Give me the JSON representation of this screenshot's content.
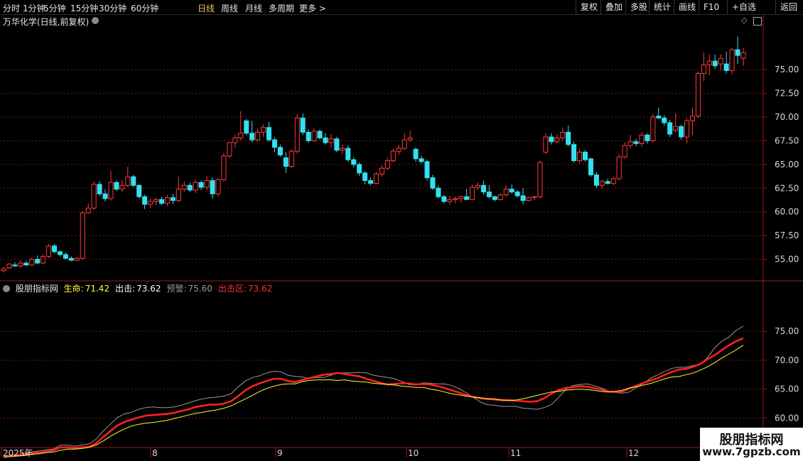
{
  "toolbar": {
    "periods": [
      "分时",
      "1分钟",
      "5分钟",
      "15分钟",
      "30分钟",
      "60分钟",
      "日线",
      "周线",
      "月线",
      "多周期",
      "更多 >"
    ],
    "active_period": "日线",
    "right_buttons": [
      "复权",
      "叠加",
      "多股",
      "统计",
      "画线",
      "F10",
      "+自选",
      "返回"
    ]
  },
  "stock_title": "万华化学(日线,前复权)",
  "indicator": {
    "name": "股朋指标网",
    "items": [
      {
        "label": "生命:",
        "value": "71.42",
        "color": "#ffff40"
      },
      {
        "label": "出击:",
        "value": "73.62",
        "color": "#ffffff"
      },
      {
        "label": "预警:",
        "value": "75.60",
        "color": "#9a9a9a"
      },
      {
        "label": "出击区:",
        "value": "73.62",
        "color": "#ff3030"
      }
    ]
  },
  "colors": {
    "up": "#ff3b3b",
    "down": "#33e0f0",
    "grid": "#7a1515",
    "axis": "#a01818"
  },
  "watermark": {
    "line1": "股朋指标网",
    "line2": "www.7gpzb.com"
  },
  "chart_data": [
    {
      "type": "candlestick",
      "title": "万华化学(日线,前复权)",
      "y_ticks": [
        55.0,
        57.5,
        60.0,
        62.5,
        65.0,
        67.5,
        70.0,
        72.5,
        75.0
      ],
      "ylim": [
        52.8,
        79.5
      ],
      "x_labels": [
        "2025年",
        "8",
        "9",
        "10",
        "11",
        "12"
      ],
      "ohlc": [
        [
          53.8,
          54.2,
          53.6,
          54.0
        ],
        [
          54.1,
          54.6,
          54.0,
          54.5
        ],
        [
          54.4,
          54.7,
          54.2,
          54.3
        ],
        [
          54.3,
          54.9,
          54.1,
          54.6
        ],
        [
          54.6,
          54.8,
          54.3,
          54.4
        ],
        [
          54.4,
          55.2,
          54.3,
          55.0
        ],
        [
          55.0,
          55.4,
          54.5,
          54.6
        ],
        [
          54.6,
          55.5,
          54.5,
          55.3
        ],
        [
          55.3,
          56.6,
          55.1,
          56.4
        ],
        [
          56.4,
          56.6,
          55.6,
          55.8
        ],
        [
          55.8,
          55.9,
          55.3,
          55.5
        ],
        [
          55.5,
          55.7,
          55.0,
          55.1
        ],
        [
          55.1,
          55.3,
          54.8,
          54.9
        ],
        [
          54.9,
          55.2,
          54.8,
          55.1
        ],
        [
          55.1,
          60.1,
          55.0,
          59.9
        ],
        [
          59.9,
          60.9,
          59.8,
          60.4
        ],
        [
          60.4,
          63.2,
          60.2,
          62.9
        ],
        [
          62.9,
          63.2,
          61.7,
          61.9
        ],
        [
          61.9,
          62.4,
          61.1,
          61.4
        ],
        [
          61.4,
          64.3,
          61.2,
          63.1
        ],
        [
          63.1,
          63.3,
          62.2,
          62.4
        ],
        [
          62.4,
          63.4,
          62.1,
          62.8
        ],
        [
          62.8,
          64.8,
          62.6,
          63.7
        ],
        [
          63.7,
          63.9,
          62.6,
          62.8
        ],
        [
          62.8,
          62.9,
          61.4,
          61.6
        ],
        [
          61.6,
          61.8,
          60.3,
          60.8
        ],
        [
          60.8,
          61.4,
          60.4,
          61.1
        ],
        [
          61.1,
          61.5,
          60.7,
          61.3
        ],
        [
          61.3,
          61.6,
          60.7,
          60.9
        ],
        [
          60.9,
          61.8,
          60.6,
          61.5
        ],
        [
          61.5,
          61.9,
          60.8,
          61.2
        ],
        [
          61.2,
          63.7,
          61.0,
          62.4
        ],
        [
          62.4,
          63.2,
          62.1,
          62.8
        ],
        [
          62.8,
          63.1,
          62.1,
          62.3
        ],
        [
          62.3,
          63.4,
          62.0,
          63.1
        ],
        [
          63.1,
          63.3,
          62.3,
          62.6
        ],
        [
          62.6,
          63.8,
          62.3,
          63.3
        ],
        [
          63.3,
          63.6,
          61.4,
          61.9
        ],
        [
          61.9,
          63.6,
          61.6,
          63.4
        ],
        [
          63.4,
          66.2,
          63.2,
          65.9
        ],
        [
          65.9,
          67.4,
          65.7,
          67.3
        ],
        [
          67.3,
          68.1,
          66.8,
          67.8
        ],
        [
          67.8,
          70.6,
          67.5,
          68.3
        ],
        [
          69.6,
          69.8,
          68.1,
          68.3
        ],
        [
          68.3,
          69.6,
          67.3,
          67.6
        ],
        [
          67.6,
          68.8,
          67.4,
          68.4
        ],
        [
          68.4,
          69.2,
          67.9,
          68.9
        ],
        [
          68.9,
          69.5,
          67.4,
          67.6
        ],
        [
          67.6,
          67.9,
          66.3,
          66.8
        ],
        [
          66.8,
          67.1,
          65.8,
          66.0
        ],
        [
          65.7,
          66.3,
          64.1,
          64.8
        ],
        [
          64.8,
          66.6,
          64.6,
          66.4
        ],
        [
          66.4,
          70.3,
          66.1,
          69.9
        ],
        [
          69.9,
          70.4,
          68.1,
          68.4
        ],
        [
          68.4,
          68.7,
          67.3,
          67.5
        ],
        [
          67.5,
          68.8,
          67.4,
          68.5
        ],
        [
          68.5,
          68.7,
          67.6,
          67.8
        ],
        [
          67.8,
          68.3,
          67.1,
          67.3
        ],
        [
          67.3,
          68.2,
          66.8,
          67.7
        ],
        [
          67.7,
          67.9,
          66.3,
          66.5
        ],
        [
          66.5,
          67.1,
          66.1,
          66.7
        ],
        [
          66.7,
          67.0,
          65.3,
          65.5
        ],
        [
          65.5,
          65.8,
          64.7,
          65.0
        ],
        [
          65.0,
          65.2,
          63.8,
          64.1
        ],
        [
          64.1,
          64.3,
          62.9,
          63.3
        ],
        [
          63.3,
          63.6,
          62.8,
          63.0
        ],
        [
          63.0,
          64.2,
          62.9,
          64.0
        ],
        [
          64.0,
          64.9,
          63.7,
          64.6
        ],
        [
          64.6,
          65.7,
          64.4,
          65.4
        ],
        [
          65.4,
          66.7,
          65.2,
          66.4
        ],
        [
          66.4,
          67.1,
          66.0,
          66.7
        ],
        [
          66.7,
          68.3,
          66.5,
          67.6
        ],
        [
          67.6,
          68.6,
          67.4,
          67.8
        ],
        [
          66.6,
          66.8,
          65.3,
          65.6
        ],
        [
          65.6,
          65.9,
          65.1,
          65.3
        ],
        [
          65.3,
          65.5,
          63.3,
          63.6
        ],
        [
          63.6,
          63.9,
          62.3,
          62.5
        ],
        [
          62.5,
          62.8,
          61.4,
          61.6
        ],
        [
          61.6,
          61.8,
          60.9,
          61.1
        ],
        [
          61.1,
          61.7,
          60.8,
          61.3
        ],
        [
          61.3,
          61.6,
          60.9,
          61.4
        ],
        [
          61.4,
          61.7,
          61.0,
          61.6
        ],
        [
          61.6,
          62.4,
          61.3,
          61.3
        ],
        [
          61.3,
          62.9,
          61.2,
          62.6
        ],
        [
          62.6,
          63.1,
          62.3,
          62.8
        ],
        [
          62.8,
          63.3,
          61.8,
          62.1
        ],
        [
          62.1,
          62.8,
          61.4,
          61.6
        ],
        [
          61.6,
          61.7,
          61.1,
          61.3
        ],
        [
          61.3,
          61.9,
          61.2,
          61.8
        ],
        [
          61.8,
          62.8,
          61.6,
          62.4
        ],
        [
          62.4,
          62.9,
          61.9,
          62.1
        ],
        [
          62.1,
          62.3,
          61.5,
          61.7
        ],
        [
          61.7,
          62.5,
          60.8,
          61.2
        ],
        [
          61.2,
          61.6,
          61.1,
          61.5
        ],
        [
          61.5,
          61.7,
          61.2,
          61.6
        ],
        [
          61.6,
          65.4,
          61.4,
          65.2
        ],
        [
          66.3,
          68.3,
          66.1,
          67.9
        ],
        [
          67.9,
          68.3,
          67.1,
          67.4
        ],
        [
          67.4,
          68.2,
          67.2,
          67.8
        ],
        [
          67.8,
          68.9,
          67.5,
          68.4
        ],
        [
          68.4,
          69.1,
          66.9,
          67.1
        ],
        [
          67.1,
          67.4,
          65.2,
          65.4
        ],
        [
          65.4,
          66.7,
          65.1,
          66.3
        ],
        [
          66.3,
          66.5,
          65.3,
          65.5
        ],
        [
          65.6,
          65.7,
          63.7,
          63.9
        ],
        [
          63.9,
          64.2,
          62.5,
          62.8
        ],
        [
          62.8,
          63.4,
          62.4,
          63.2
        ],
        [
          63.2,
          63.5,
          62.9,
          63.0
        ],
        [
          63.0,
          63.7,
          62.8,
          63.5
        ],
        [
          63.5,
          66.1,
          63.3,
          65.8
        ],
        [
          65.8,
          67.3,
          65.6,
          67.0
        ],
        [
          67.0,
          68.1,
          66.7,
          67.4
        ],
        [
          67.4,
          67.7,
          66.9,
          67.2
        ],
        [
          67.2,
          68.4,
          66.9,
          68.1
        ],
        [
          68.1,
          68.3,
          67.2,
          67.5
        ],
        [
          67.5,
          70.3,
          67.3,
          70.0
        ],
        [
          70.1,
          71.0,
          69.8,
          69.9
        ],
        [
          69.9,
          70.2,
          69.1,
          69.4
        ],
        [
          69.4,
          69.7,
          67.9,
          68.2
        ],
        [
          68.6,
          70.4,
          68.4,
          69.0
        ],
        [
          69.0,
          69.2,
          67.6,
          67.9
        ],
        [
          67.9,
          69.9,
          67.2,
          69.6
        ],
        [
          69.6,
          71.0,
          68.1,
          70.1
        ],
        [
          70.1,
          74.8,
          69.9,
          74.6
        ],
        [
          74.6,
          76.8,
          73.8,
          75.5
        ],
        [
          75.5,
          76.6,
          74.4,
          75.9
        ],
        [
          75.9,
          76.6,
          75.1,
          75.4
        ],
        [
          75.6,
          76.6,
          74.9,
          76.2
        ],
        [
          75.6,
          76.9,
          74.6,
          74.9
        ],
        [
          74.9,
          77.3,
          74.5,
          77.1
        ],
        [
          77.1,
          78.5,
          75.6,
          76.5
        ],
        [
          76.2,
          77.3,
          75.4,
          76.8
        ]
      ]
    },
    {
      "type": "line",
      "y_ticks": [
        60.0,
        65.0,
        70.0,
        75.0
      ],
      "ylim": [
        55.0,
        80.8
      ],
      "series": [
        {
          "name": "预警",
          "color": "#9a9a9a",
          "values": [
            53.2,
            53.5,
            53.7,
            53.9,
            54.1,
            54.3,
            54.5,
            54.6,
            55.3,
            55.3,
            55.1,
            55.3,
            55.5,
            56.3,
            57.7,
            58.9,
            60.1,
            60.7,
            61.0,
            61.5,
            61.8,
            61.9,
            61.8,
            61.8,
            61.9,
            62.2,
            62.6,
            63.0,
            63.3,
            63.5,
            63.6,
            63.8,
            64.2,
            65.4,
            66.4,
            67.0,
            67.3,
            67.8,
            68.1,
            68.0,
            67.4,
            67.2,
            67.1,
            66.8,
            67.0,
            67.0,
            67.4,
            67.8,
            67.8,
            67.8,
            67.9,
            67.8,
            67.4,
            67.2,
            67.0,
            66.8,
            66.3,
            65.8,
            65.7,
            66.1,
            66.0,
            65.9,
            65.9,
            65.6,
            65.1,
            64.4,
            63.6,
            62.8,
            62.3,
            62.2,
            62.0,
            62.0,
            62.0,
            61.7,
            61.6,
            61.5,
            61.8,
            62.3,
            63.5,
            64.9,
            65.6,
            65.8,
            65.9,
            65.6,
            65.2,
            64.7,
            64.4,
            64.3,
            64.5,
            65.3,
            66.0,
            66.9,
            67.5,
            68.1,
            68.6,
            68.8,
            68.8,
            69.1,
            69.3,
            70.5,
            72.2,
            73.3,
            74.0,
            75.2,
            75.9
          ]
        },
        {
          "name": "出击",
          "color": "#ff2020",
          "values": [
            53.3,
            53.5,
            53.6,
            53.7,
            53.9,
            54.0,
            54.2,
            54.4,
            54.9,
            54.9,
            54.8,
            54.9,
            55.0,
            55.6,
            56.7,
            57.7,
            58.7,
            59.3,
            59.7,
            60.1,
            60.4,
            60.5,
            60.6,
            60.7,
            60.9,
            61.2,
            61.5,
            61.9,
            62.1,
            62.3,
            62.3,
            62.5,
            62.9,
            63.8,
            64.8,
            65.5,
            66.0,
            66.4,
            66.8,
            66.8,
            66.4,
            66.2,
            66.6,
            66.9,
            67.2,
            67.5,
            67.6,
            67.8,
            67.6,
            67.4,
            67.2,
            66.8,
            66.4,
            66.1,
            65.8,
            65.9,
            66.0,
            66.0,
            65.8,
            65.9,
            65.8,
            65.5,
            65.2,
            64.8,
            64.4,
            64.0,
            63.7,
            63.4,
            63.3,
            63.2,
            63.1,
            63.1,
            63.0,
            62.9,
            62.8,
            62.9,
            63.4,
            64.2,
            64.8,
            65.2,
            65.3,
            65.5,
            65.4,
            65.2,
            64.9,
            64.6,
            64.5,
            64.6,
            65.1,
            65.6,
            66.1,
            66.5,
            66.9,
            67.5,
            68.0,
            68.4,
            68.5,
            68.9,
            69.4,
            70.2,
            70.9,
            71.8,
            72.6,
            73.3,
            73.8
          ]
        },
        {
          "name": "生命",
          "color": "#ffff30",
          "values": [
            53.2,
            53.3,
            53.4,
            53.5,
            53.7,
            53.8,
            54.0,
            54.1,
            54.4,
            54.6,
            54.6,
            54.7,
            54.9,
            55.3,
            56.0,
            56.8,
            57.5,
            58.1,
            58.6,
            58.9,
            59.1,
            59.2,
            59.4,
            59.6,
            59.9,
            60.2,
            60.5,
            60.8,
            61.0,
            61.2,
            61.4,
            61.7,
            62.1,
            62.7,
            63.3,
            63.9,
            64.6,
            65.1,
            65.5,
            65.8,
            65.9,
            65.9,
            66.3,
            66.5,
            66.6,
            66.6,
            66.6,
            66.5,
            66.6,
            66.4,
            66.3,
            66.2,
            66.0,
            65.9,
            65.8,
            65.7,
            65.5,
            65.4,
            65.3,
            65.3,
            65.0,
            64.8,
            64.5,
            64.2,
            64.0,
            63.8,
            63.6,
            63.5,
            63.3,
            63.3,
            63.1,
            63.0,
            63.1,
            63.3,
            63.6,
            63.9,
            64.2,
            64.5,
            64.6,
            64.8,
            64.9,
            65.0,
            64.9,
            64.8,
            64.6,
            64.5,
            64.6,
            64.8,
            65.2,
            65.4,
            65.7,
            66.0,
            66.4,
            66.8,
            67.1,
            67.2,
            67.5,
            67.8,
            68.3,
            68.9,
            69.6,
            70.4,
            71.1,
            71.8,
            72.6
          ]
        }
      ]
    }
  ]
}
